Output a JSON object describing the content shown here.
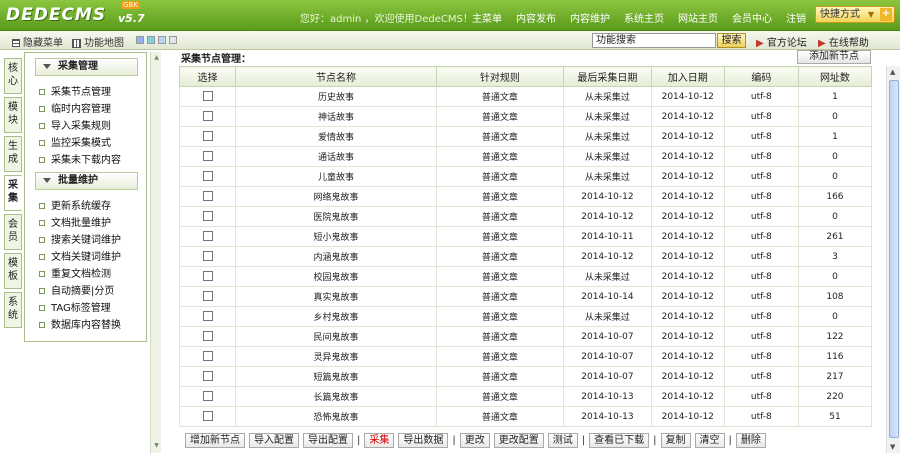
{
  "header": {
    "logo": "DEDECMS",
    "version": "v5.7",
    "badge": "GBK",
    "welcome": "您好：admin ，欢迎使用DedeCMS！",
    "nav": [
      "主菜单",
      "内容发布",
      "内容维护",
      "系统主页",
      "网站主页",
      "会员中心",
      "注销"
    ],
    "quick": "快捷方式",
    "quick_plus": "+"
  },
  "subbar": {
    "hide_menu": "隐藏菜单",
    "feature_map": "功能地图",
    "search_value": "功能搜索",
    "search_button": "搜索",
    "forum": "官方论坛",
    "help": "在线帮助",
    "swatches": [
      "#8fb3e8",
      "#7ed0e0",
      "#b4d7f5",
      "#e5e5e5"
    ]
  },
  "vtabs": [
    "核心",
    "模块",
    "生成",
    "采集",
    "会员",
    "模板",
    "系统"
  ],
  "sidebar": {
    "groups": [
      {
        "title": "采集管理",
        "items": [
          "采集节点管理",
          "临时内容管理",
          "导入采集规则",
          "监控采集模式",
          "采集未下载内容"
        ]
      },
      {
        "title": "批量维护",
        "items": [
          "更新系统缓存",
          "文档批量维护",
          "搜索关键词维护",
          "文档关键词维护",
          "重复文档检测",
          "自动摘要|分页",
          "TAG标签管理",
          "数据库内容替换"
        ]
      }
    ]
  },
  "main": {
    "title": "采集节点管理：",
    "add_new": "添加新节点",
    "columns": [
      "选择",
      "节点名称",
      "针对规则",
      "最后采集日期",
      "加入日期",
      "编码",
      "网址数"
    ],
    "rows": [
      [
        "历史故事",
        "普通文章",
        "从未采集过",
        "2014-10-12",
        "utf-8",
        "1"
      ],
      [
        "神话故事",
        "普通文章",
        "从未采集过",
        "2014-10-12",
        "utf-8",
        "0"
      ],
      [
        "爱情故事",
        "普通文章",
        "从未采集过",
        "2014-10-12",
        "utf-8",
        "1"
      ],
      [
        "通话故事",
        "普通文章",
        "从未采集过",
        "2014-10-12",
        "utf-8",
        "0"
      ],
      [
        "儿童故事",
        "普通文章",
        "从未采集过",
        "2014-10-12",
        "utf-8",
        "0"
      ],
      [
        "网络鬼故事",
        "普通文章",
        "2014-10-12",
        "2014-10-12",
        "utf-8",
        "166"
      ],
      [
        "医院鬼故事",
        "普通文章",
        "2014-10-12",
        "2014-10-12",
        "utf-8",
        "0"
      ],
      [
        "短小鬼故事",
        "普通文章",
        "2014-10-11",
        "2014-10-12",
        "utf-8",
        "261"
      ],
      [
        "内涵鬼故事",
        "普通文章",
        "2014-10-12",
        "2014-10-12",
        "utf-8",
        "3"
      ],
      [
        "校园鬼故事",
        "普通文章",
        "从未采集过",
        "2014-10-12",
        "utf-8",
        "0"
      ],
      [
        "真实鬼故事",
        "普通文章",
        "2014-10-14",
        "2014-10-12",
        "utf-8",
        "108"
      ],
      [
        "乡村鬼故事",
        "普通文章",
        "从未采集过",
        "2014-10-12",
        "utf-8",
        "0"
      ],
      [
        "民间鬼故事",
        "普通文章",
        "2014-10-07",
        "2014-10-12",
        "utf-8",
        "122"
      ],
      [
        "灵异鬼故事",
        "普通文章",
        "2014-10-07",
        "2014-10-12",
        "utf-8",
        "116"
      ],
      [
        "短篇鬼故事",
        "普通文章",
        "2014-10-07",
        "2014-10-12",
        "utf-8",
        "217"
      ],
      [
        "长篇鬼故事",
        "普通文章",
        "2014-10-13",
        "2014-10-12",
        "utf-8",
        "220"
      ],
      [
        "恐怖鬼故事",
        "普通文章",
        "2014-10-13",
        "2014-10-12",
        "utf-8",
        "51"
      ]
    ],
    "actions": [
      {
        "label": "增加新节点",
        "red": false
      },
      {
        "label": "导入配置",
        "red": false
      },
      {
        "label": "导出配置",
        "red": false
      },
      {
        "sep": "|"
      },
      {
        "label": "采集",
        "red": true
      },
      {
        "label": "导出数据",
        "red": false
      },
      {
        "sep": "|"
      },
      {
        "label": "更改",
        "red": false
      },
      {
        "label": "更改配置",
        "red": false
      },
      {
        "label": "测试",
        "red": false
      },
      {
        "sep": "|"
      },
      {
        "label": "查看已下载",
        "red": false
      },
      {
        "sep": "|"
      },
      {
        "label": "复制",
        "red": false
      },
      {
        "label": "清空",
        "red": false
      },
      {
        "sep": "|"
      },
      {
        "label": "删除",
        "red": false
      }
    ]
  }
}
